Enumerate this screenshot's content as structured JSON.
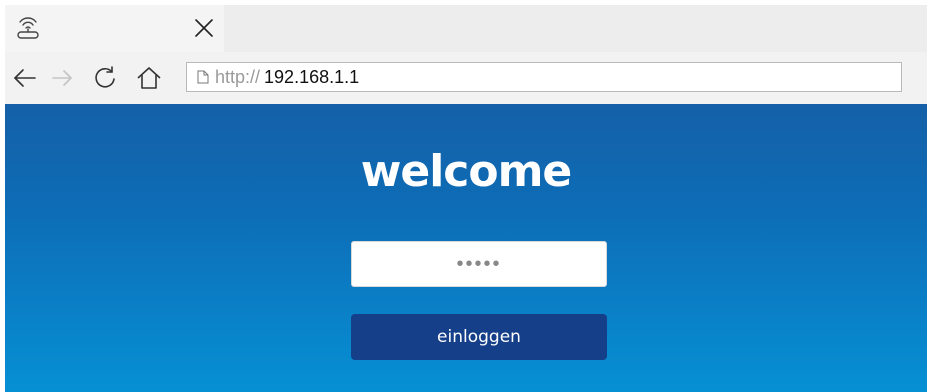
{
  "browser": {
    "tab": {
      "favicon": "router-wifi-icon",
      "close": "close-icon"
    },
    "nav": {
      "back": "arrow-left-icon",
      "forward": "arrow-right-icon",
      "reload": "reload-icon",
      "home": "home-icon"
    },
    "address": {
      "protocol": "http://",
      "host": "192.168.1.1",
      "page_icon": "page-icon"
    }
  },
  "page": {
    "heading": "welcome",
    "password_value": "•••••",
    "login_label": "einloggen"
  },
  "colors": {
    "login_button": "#163f8a",
    "background_top": "#1560a8",
    "background_bottom": "#0690d4"
  }
}
